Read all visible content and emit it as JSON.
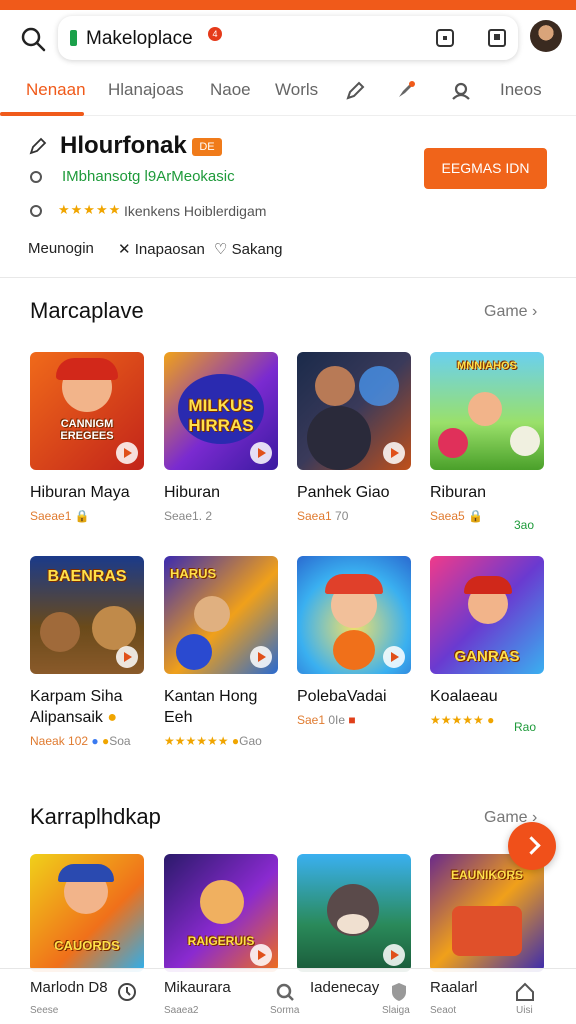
{
  "header": {
    "url_text": "Makeloplace",
    "url_badge": "4"
  },
  "tabs": [
    {
      "label": "Nenaan",
      "active": true
    },
    {
      "label": "Hlanajoas"
    },
    {
      "label": "Naoe"
    },
    {
      "label": "Worls"
    },
    {
      "label": "Ineos"
    }
  ],
  "profile": {
    "name": "Hlourfonak",
    "name_badge": "DE",
    "line1": "IMbhansotg l9ArMeokasic",
    "stars": "★★★★★",
    "line2": "Ikenkens Hoiblerdigam",
    "actions": [
      "Meunogin",
      "Inapaosan",
      "Sakang"
    ],
    "cta_label": "EEGMAS IDN"
  },
  "section1": {
    "title": "Marcaplave",
    "more": "Game",
    "cards": [
      {
        "thumb_text": "CANNIGM EREGEES",
        "title": "Hiburan Maya",
        "meta": "Saeae1",
        "meta2": ""
      },
      {
        "thumb_text": "MILKUS HIRRAS",
        "title": "Hiburan",
        "meta": "",
        "meta2": "Seae1. 2"
      },
      {
        "thumb_text": "",
        "title": "Panhek Giao",
        "meta": "Saea1",
        "meta2": "70"
      },
      {
        "thumb_text": "MNNIAHOS",
        "title": "Riburan",
        "meta": "Saea5",
        "meta2": "",
        "tag": "3ao"
      },
      {
        "thumb_text": "BAENRAS",
        "title": "Karpam Siha",
        "title2": "Alipansaik",
        "meta": "Naeak 102",
        "meta2": "Soa"
      },
      {
        "thumb_text": "HARUS",
        "title": "Kantan Hong",
        "title2": "Eeh",
        "meta": "★★★★★★",
        "meta2": "Gao"
      },
      {
        "thumb_text": "",
        "title": "PolebaVadai",
        "meta": "Sae1",
        "meta2": "0Ie"
      },
      {
        "thumb_text": "GANRAS",
        "title": "Koalaeau",
        "meta": "★★★★★",
        "meta2": "",
        "tag": "Rao"
      }
    ]
  },
  "section2": {
    "title": "Karraplhdkap",
    "more": "Game",
    "cards": [
      {
        "thumb_text": "CAUORDS"
      },
      {
        "thumb_text": "RAIGERUIS"
      },
      {
        "thumb_text": ""
      },
      {
        "thumb_text": "EAUNIKORS"
      }
    ]
  },
  "bottom_nav": [
    {
      "label": "Marlodn D8",
      "sub": "Seese"
    },
    {
      "label": "Mikaurara",
      "sub": "Saaea2"
    },
    {
      "label": "Iadenecay",
      "sub": "Sorma"
    },
    {
      "label": "Raalarl",
      "sub": "Seaot"
    }
  ],
  "bottom_sub_extra": [
    "Slaiga",
    "Uisi"
  ],
  "colors": {
    "accent": "#f05a1a",
    "green": "#1e9a3a"
  }
}
